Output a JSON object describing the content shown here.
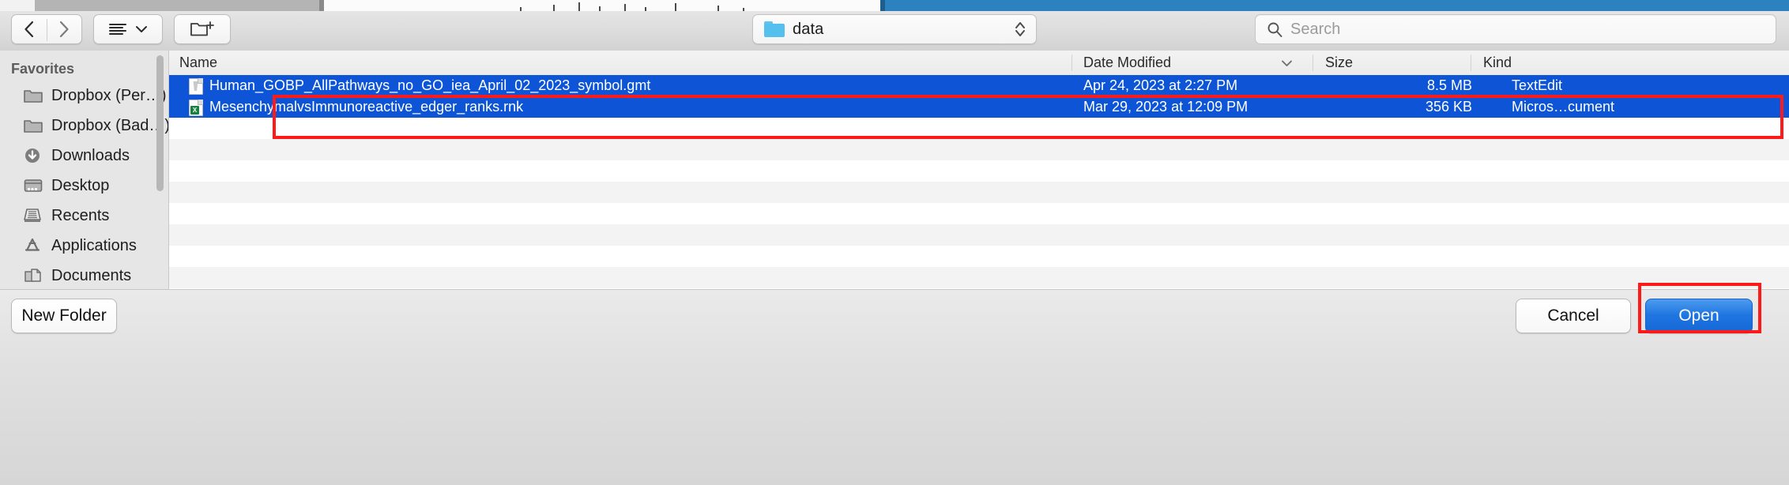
{
  "toolbar": {
    "back_icon": "chevron-left-icon",
    "forward_icon": "chevron-right-icon",
    "view_icon": "list-view-icon",
    "view_chevron_icon": "chevron-down-icon",
    "new_folder_icon": "new-folder-icon",
    "path": {
      "label": "data",
      "folder_icon": "blue-folder-icon",
      "stepper_icon": "up-down-stepper-icon"
    },
    "search": {
      "icon": "search-icon",
      "placeholder": "Search",
      "value": ""
    }
  },
  "sidebar": {
    "title": "Favorites",
    "items": [
      {
        "label": "Dropbox (Per…)",
        "icon": "folder-icon"
      },
      {
        "label": "Dropbox (Bad…)",
        "icon": "folder-icon"
      },
      {
        "label": "Downloads",
        "icon": "downloads-arrow-icon"
      },
      {
        "label": "Desktop",
        "icon": "desktop-icon"
      },
      {
        "label": "Recents",
        "icon": "recents-tray-icon"
      },
      {
        "label": "Applications",
        "icon": "applications-icon"
      },
      {
        "label": "Documents",
        "icon": "documents-icon"
      },
      {
        "label": "",
        "icon": "home-icon"
      }
    ]
  },
  "filelist": {
    "columns": [
      "Name",
      "Date Modified",
      "Size",
      "Kind"
    ],
    "sort_icon": "chevron-down-icon",
    "rows": [
      {
        "name": "Human_GOBP_AllPathways_no_GO_iea_April_02_2023_symbol.gmt",
        "date": "Apr 24, 2023 at 2:27 PM",
        "size": "8.5 MB",
        "kind": "TextEdit",
        "icon": "text-document-icon",
        "selected": true
      },
      {
        "name": "MesenchymalvsImmunoreactive_edger_ranks.rnk",
        "date": "Mar 29, 2023 at 12:09 PM",
        "size": "356 KB",
        "kind": "Micros…cument",
        "icon": "excel-document-icon",
        "selected": true
      }
    ]
  },
  "footer": {
    "new_folder_label": "New Folder",
    "cancel_label": "Cancel",
    "open_label": "Open"
  },
  "annotations": {
    "color": "#ff1a1a",
    "targets": [
      "selected-file-rows",
      "open-button"
    ]
  },
  "colors": {
    "selection_blue": "#0d55d6",
    "default_button_blue": "#1f75e0",
    "annotation_red": "#ff1a1a",
    "folder_blue": "#55c0ee"
  }
}
